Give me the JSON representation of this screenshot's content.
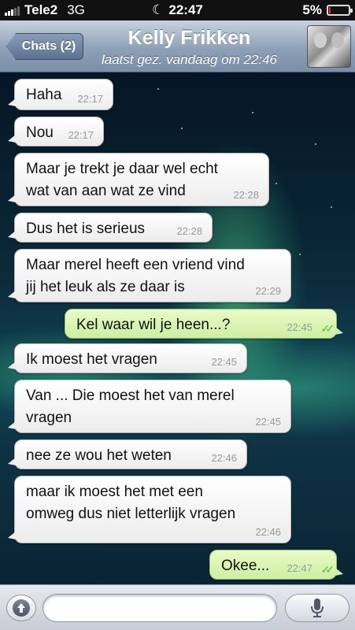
{
  "status_bar": {
    "carrier": "Tele2",
    "network": "3G",
    "time": "22:47",
    "battery_text": "5%",
    "battery_level": 0.05
  },
  "nav": {
    "back_label": "Chats (2)",
    "contact_name": "Kelly Frikken",
    "last_seen": "laatst gez. vandaag om 22:46"
  },
  "messages": [
    {
      "direction": "in",
      "text": "Haha",
      "time": "22:17"
    },
    {
      "direction": "in",
      "text": "Nou",
      "time": "22:17"
    },
    {
      "direction": "in",
      "text": "Maar je trekt je daar wel echt\nwat van aan wat ze vind",
      "time": "22:28"
    },
    {
      "direction": "in",
      "text": "Dus het is serieus",
      "time": "22:28"
    },
    {
      "direction": "in",
      "text": "Maar merel heeft een vriend vind\njij het leuk als ze daar is",
      "time": "22:29"
    },
    {
      "direction": "out",
      "text": "Kel waar wil je heen...?",
      "time": "22:45",
      "read": true
    },
    {
      "direction": "in",
      "text": "Ik moest het vragen",
      "time": "22:45"
    },
    {
      "direction": "in",
      "text": "Van ... Die moest het van merel\nvragen",
      "time": "22:45"
    },
    {
      "direction": "in",
      "text": "nee ze wou het weten",
      "time": "22:46"
    },
    {
      "direction": "in",
      "text": "maar ik moest het met een\nomweg dus niet letterlijk vragen",
      "time": "22:46"
    },
    {
      "direction": "out",
      "text": "Okee...",
      "time": "22:47",
      "read": true
    }
  ],
  "input": {
    "value": "",
    "placeholder": ""
  },
  "icons": {
    "attach": "upload-arrow-icon",
    "mic": "microphone-icon",
    "read_receipt": "double-check-icon",
    "moon": "moon-icon"
  },
  "colors": {
    "read_tick": "#4fbf3b",
    "outgoing_bubble": "#d6f2ae",
    "incoming_bubble": "#ffffff",
    "battery_low": "#e8342b"
  }
}
